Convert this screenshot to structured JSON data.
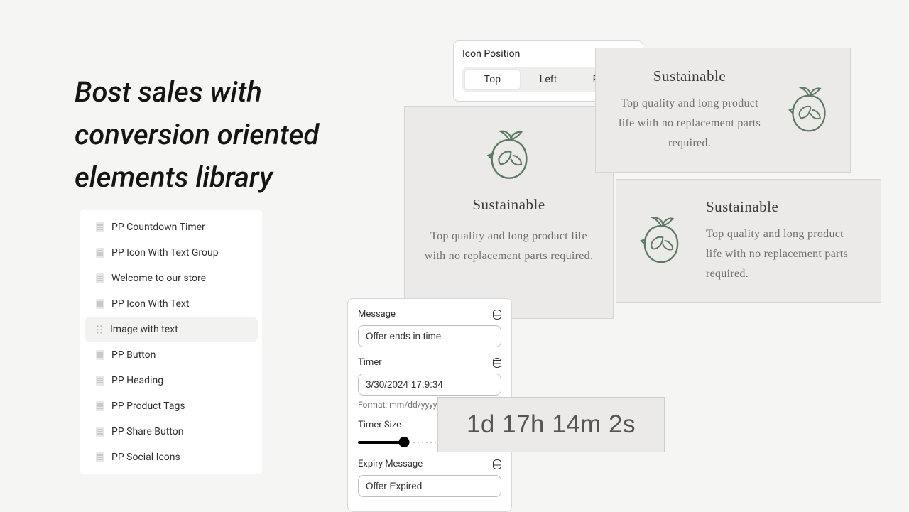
{
  "headline": "Bost sales with conversion oriented elements library",
  "elements": [
    "PP Countdown Timer",
    "PP Icon With Text Group",
    "Welcome to our store",
    "PP Icon With Text",
    "Image with text",
    "PP Button",
    "PP Heading",
    "PP Product Tags",
    "PP Share Button",
    "PP Social Icons"
  ],
  "elements_selected_index": 4,
  "icon_position": {
    "label": "Icon Position",
    "options": [
      "Top",
      "Left",
      "Right"
    ],
    "selected": "Top"
  },
  "feature": {
    "title": "Sustainable",
    "body": "Top quality and long product life with no replacement parts required."
  },
  "config": {
    "message_label": "Message",
    "message_value": "Offer ends in time",
    "timer_label": "Timer",
    "timer_value": "3/30/2024 17:9:34",
    "timer_format_hint": "Format: mm/dd/yyyy",
    "timer_size_label": "Timer Size",
    "timer_size_percent": 32,
    "expiry_label": "Expiry Message",
    "expiry_value": "Offer Expired"
  },
  "countdown_display": "1d 17h 14m 2s"
}
